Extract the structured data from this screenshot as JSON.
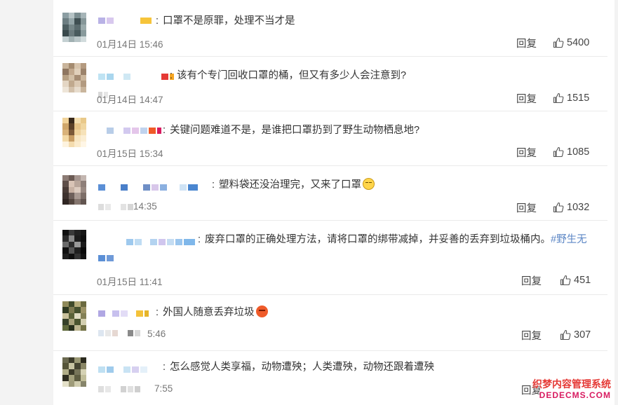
{
  "comments": [
    {
      "text": "口罩不是原罪，处理不当才是",
      "time": "01月14日 15:46",
      "reply_label": "回复",
      "likes": "5400",
      "emoji": ""
    },
    {
      "text": "该有个专门回收口罩的桶，但又有多少人会注意到?",
      "time": "01月14日 14:47",
      "reply_label": "回复",
      "likes": "1515",
      "emoji": ""
    },
    {
      "text": "关键问题难道不是，是谁把口罩扔到了野生动物栖息地?",
      "time": "01月15日 15:34",
      "reply_label": "回复",
      "likes": "1085",
      "emoji": ""
    },
    {
      "text": "塑料袋还没治理完，又来了口罩",
      "time": "14:35",
      "reply_label": "回复",
      "likes": "1032",
      "emoji": "smile-emoji"
    },
    {
      "text": "废弃口罩的正确处理方法，请将口罩的绑带减掉，并妥善的丢弃到垃圾桶内。",
      "tag": "#野生无",
      "time": "01月15日 11:41",
      "reply_label": "回复",
      "likes": "451",
      "emoji": ""
    },
    {
      "text": "外国人随意丢弃垃圾",
      "time": "5:46",
      "reply_label": "回复",
      "likes": "307",
      "emoji": "angry-emoji"
    },
    {
      "text": "怎么感觉人类享福，动物遭殃；人类遭殃，动物还跟着遭殃",
      "time": "7:55",
      "reply_label": "回复",
      "likes": "",
      "emoji": ""
    }
  ],
  "watermark": {
    "line1": "织梦内容管理系统",
    "line2": "DEDECMS.COM"
  },
  "icons": {
    "like": "thumbs-up-icon"
  }
}
